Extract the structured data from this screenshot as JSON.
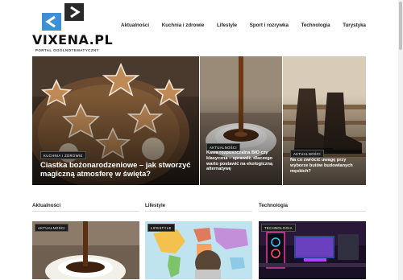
{
  "brand": {
    "name": "VIXENA.PL",
    "tagline": "PORTAL OGÓLNOTEMATYCZNY",
    "colors": {
      "icon_blue": "#3f8fd6",
      "icon_dark": "#2a2a2a"
    }
  },
  "nav": {
    "items": [
      {
        "label": "Aktualności"
      },
      {
        "label": "Kuchnia i zdrowie"
      },
      {
        "label": "Lifestyle"
      },
      {
        "label": "Sport i rozrywka"
      },
      {
        "label": "Technologia"
      },
      {
        "label": "Turystyka"
      }
    ]
  },
  "hero": [
    {
      "category": "KUCHNIA I ZDROWIE",
      "title": "Ciastka bożonarodzeniowe – jak stworzyć magiczną atmosferę w święta?"
    },
    {
      "category": "AKTUALNOŚCI",
      "title": "Kawa rozpuszczalna BIO czy klasyczna – sprawdź, dlaczego warto postawić na ekologiczną alternatywę"
    },
    {
      "category": "AKTUALNOŚCI",
      "title": "Na co zwrócić uwagę przy wyborze butów budowlanych męskich?"
    }
  ],
  "sections": [
    {
      "heading": "Aktualności",
      "badge": "AKTUALNOŚCI"
    },
    {
      "heading": "Lifestyle",
      "badge": "LIFESTYLE"
    },
    {
      "heading": "Technologia",
      "badge": "TECHNOLOGIA"
    }
  ]
}
